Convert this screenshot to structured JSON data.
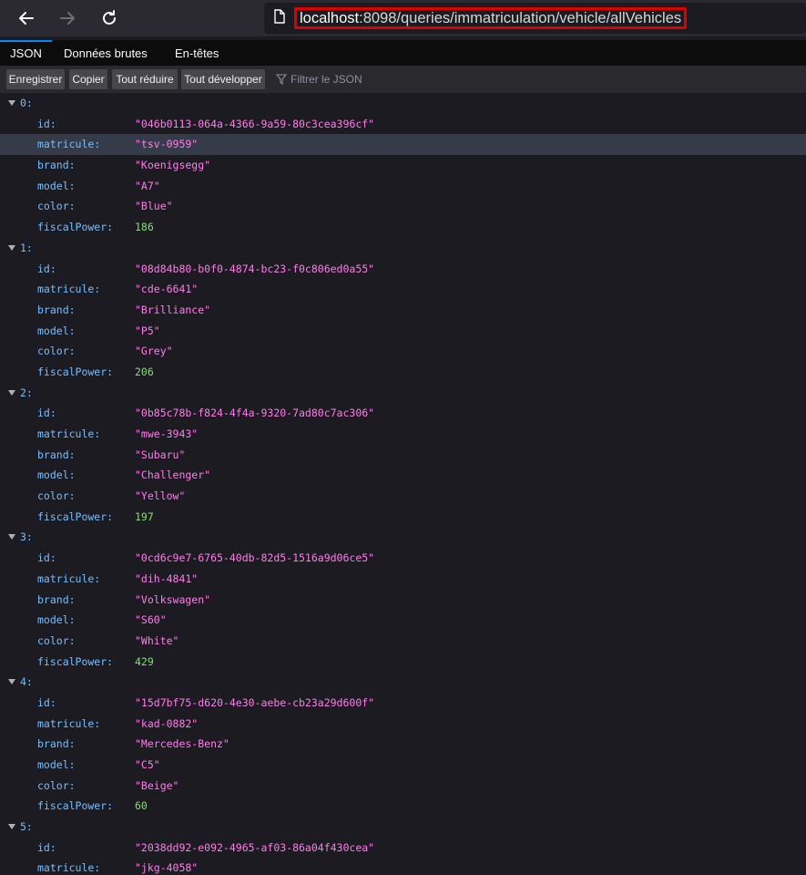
{
  "url": {
    "host": "localhost",
    "rest": ":8098/queries/immatriculation/vehicle/allVehicles"
  },
  "tabs": [
    "JSON",
    "Données brutes",
    "En-têtes"
  ],
  "toolbar": {
    "save": "Enregistrer",
    "copy": "Copier",
    "collapse_all": "Tout réduire",
    "expand_all": "Tout développer",
    "filter_placeholder": "Filtrer le JSON"
  },
  "keys": {
    "id": "id:",
    "matricule": "matricule:",
    "brand": "brand:",
    "model": "model:",
    "color": "color:",
    "fiscalPower": "fiscalPower:"
  },
  "vehicles": [
    {
      "index": "0:",
      "id": "\"046b0113-064a-4366-9a59-80c3cea396cf\"",
      "matricule": "\"tsv-0959\"",
      "brand": "\"Koenigsegg\"",
      "model": "\"A7\"",
      "color": "\"Blue\"",
      "fiscalPower": "186"
    },
    {
      "index": "1:",
      "id": "\"08d84b80-b0f0-4874-bc23-f0c806ed0a55\"",
      "matricule": "\"cde-6641\"",
      "brand": "\"Brilliance\"",
      "model": "\"P5\"",
      "color": "\"Grey\"",
      "fiscalPower": "206"
    },
    {
      "index": "2:",
      "id": "\"0b85c78b-f824-4f4a-9320-7ad80c7ac306\"",
      "matricule": "\"mwe-3943\"",
      "brand": "\"Subaru\"",
      "model": "\"Challenger\"",
      "color": "\"Yellow\"",
      "fiscalPower": "197"
    },
    {
      "index": "3:",
      "id": "\"0cd6c9e7-6765-40db-82d5-1516a9d06ce5\"",
      "matricule": "\"dih-4841\"",
      "brand": "\"Volkswagen\"",
      "model": "\"S60\"",
      "color": "\"White\"",
      "fiscalPower": "429"
    },
    {
      "index": "4:",
      "id": "\"15d7bf75-d620-4e30-aebe-cb23a29d600f\"",
      "matricule": "\"kad-0882\"",
      "brand": "\"Mercedes-Benz\"",
      "model": "\"C5\"",
      "color": "\"Beige\"",
      "fiscalPower": "60"
    },
    {
      "index": "5:",
      "id": "\"2038dd92-e092-4965-af03-86a04f430cea\"",
      "matricule": "\"jkg-4058\""
    }
  ]
}
